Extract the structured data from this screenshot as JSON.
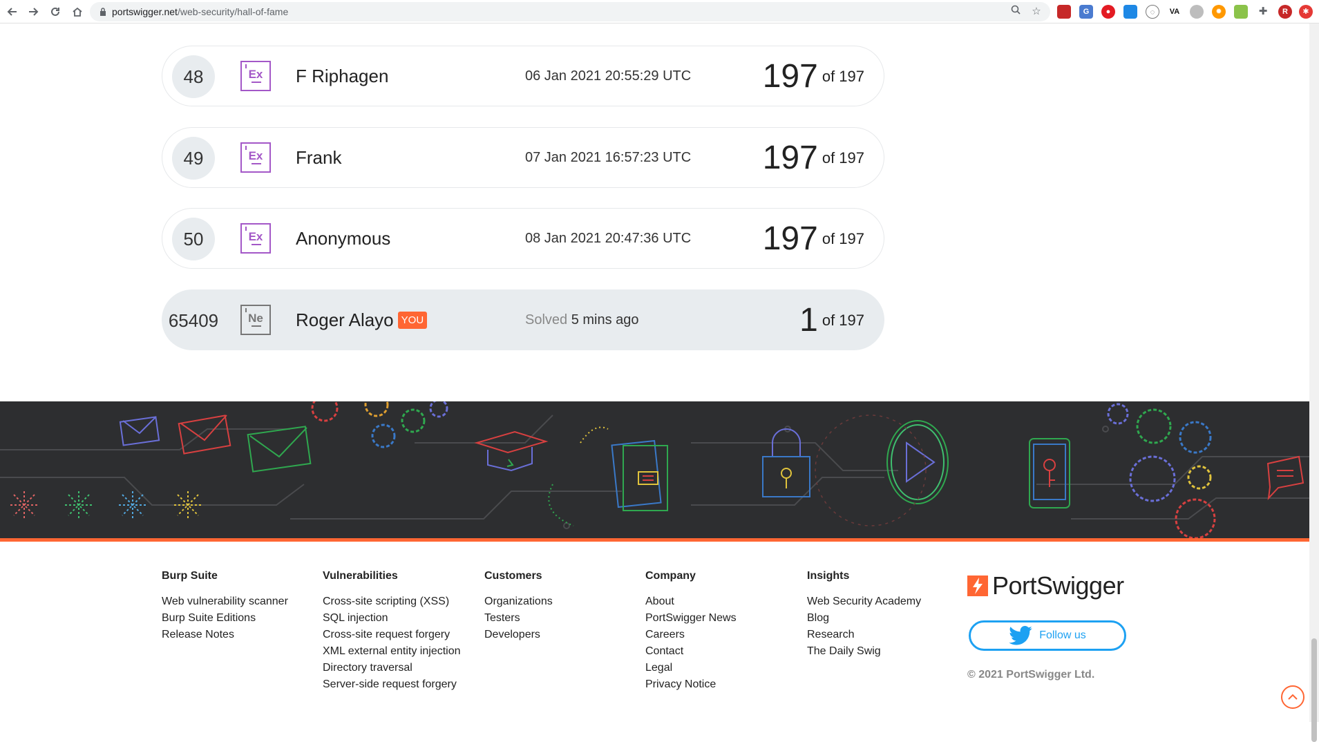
{
  "browser": {
    "url_host": "portswigger.net",
    "url_path": "/web-security/hall-of-fame",
    "profile_initial": "R",
    "ext_va": "VA"
  },
  "leaderboard": [
    {
      "rank": "48",
      "badge": "Ex",
      "name": "F Riphagen",
      "date": "06 Jan 2021 20:55:29 UTC",
      "score": "197",
      "of": "of 197"
    },
    {
      "rank": "49",
      "badge": "Ex",
      "name": "Frank",
      "date": "07 Jan 2021 16:57:23 UTC",
      "score": "197",
      "of": "of 197"
    },
    {
      "rank": "50",
      "badge": "Ex",
      "name": "Anonymous",
      "date": "08 Jan 2021 20:47:36 UTC",
      "score": "197",
      "of": "of 197"
    }
  ],
  "you_row": {
    "rank": "65409",
    "badge": "Ne",
    "name": "Roger Alayo",
    "you_tag": "YOU",
    "solved_prefix": "Solved",
    "solved_when": "5 mins ago",
    "score": "1",
    "of": "of 197"
  },
  "footer": {
    "columns": [
      {
        "title": "Burp Suite",
        "links": [
          "Web vulnerability scanner",
          "Burp Suite Editions",
          "Release Notes"
        ]
      },
      {
        "title": "Vulnerabilities",
        "links": [
          "Cross-site scripting (XSS)",
          "SQL injection",
          "Cross-site request forgery",
          "XML external entity injection",
          "Directory traversal",
          "Server-side request forgery"
        ]
      },
      {
        "title": "Customers",
        "links": [
          "Organizations",
          "Testers",
          "Developers"
        ]
      },
      {
        "title": "Company",
        "links": [
          "About",
          "PortSwigger News",
          "Careers",
          "Contact",
          "Legal",
          "Privacy Notice"
        ]
      },
      {
        "title": "Insights",
        "links": [
          "Web Security Academy",
          "Blog",
          "Research",
          "The Daily Swig"
        ]
      }
    ],
    "logo_text": "PortSwigger",
    "follow_label": "Follow us",
    "copyright": "© 2021 PortSwigger Ltd."
  },
  "colors": {
    "accent": "#ff6633",
    "expert_badge": "#a357c7",
    "twitter": "#1da1f2",
    "banner_bg": "#2d2e30"
  }
}
